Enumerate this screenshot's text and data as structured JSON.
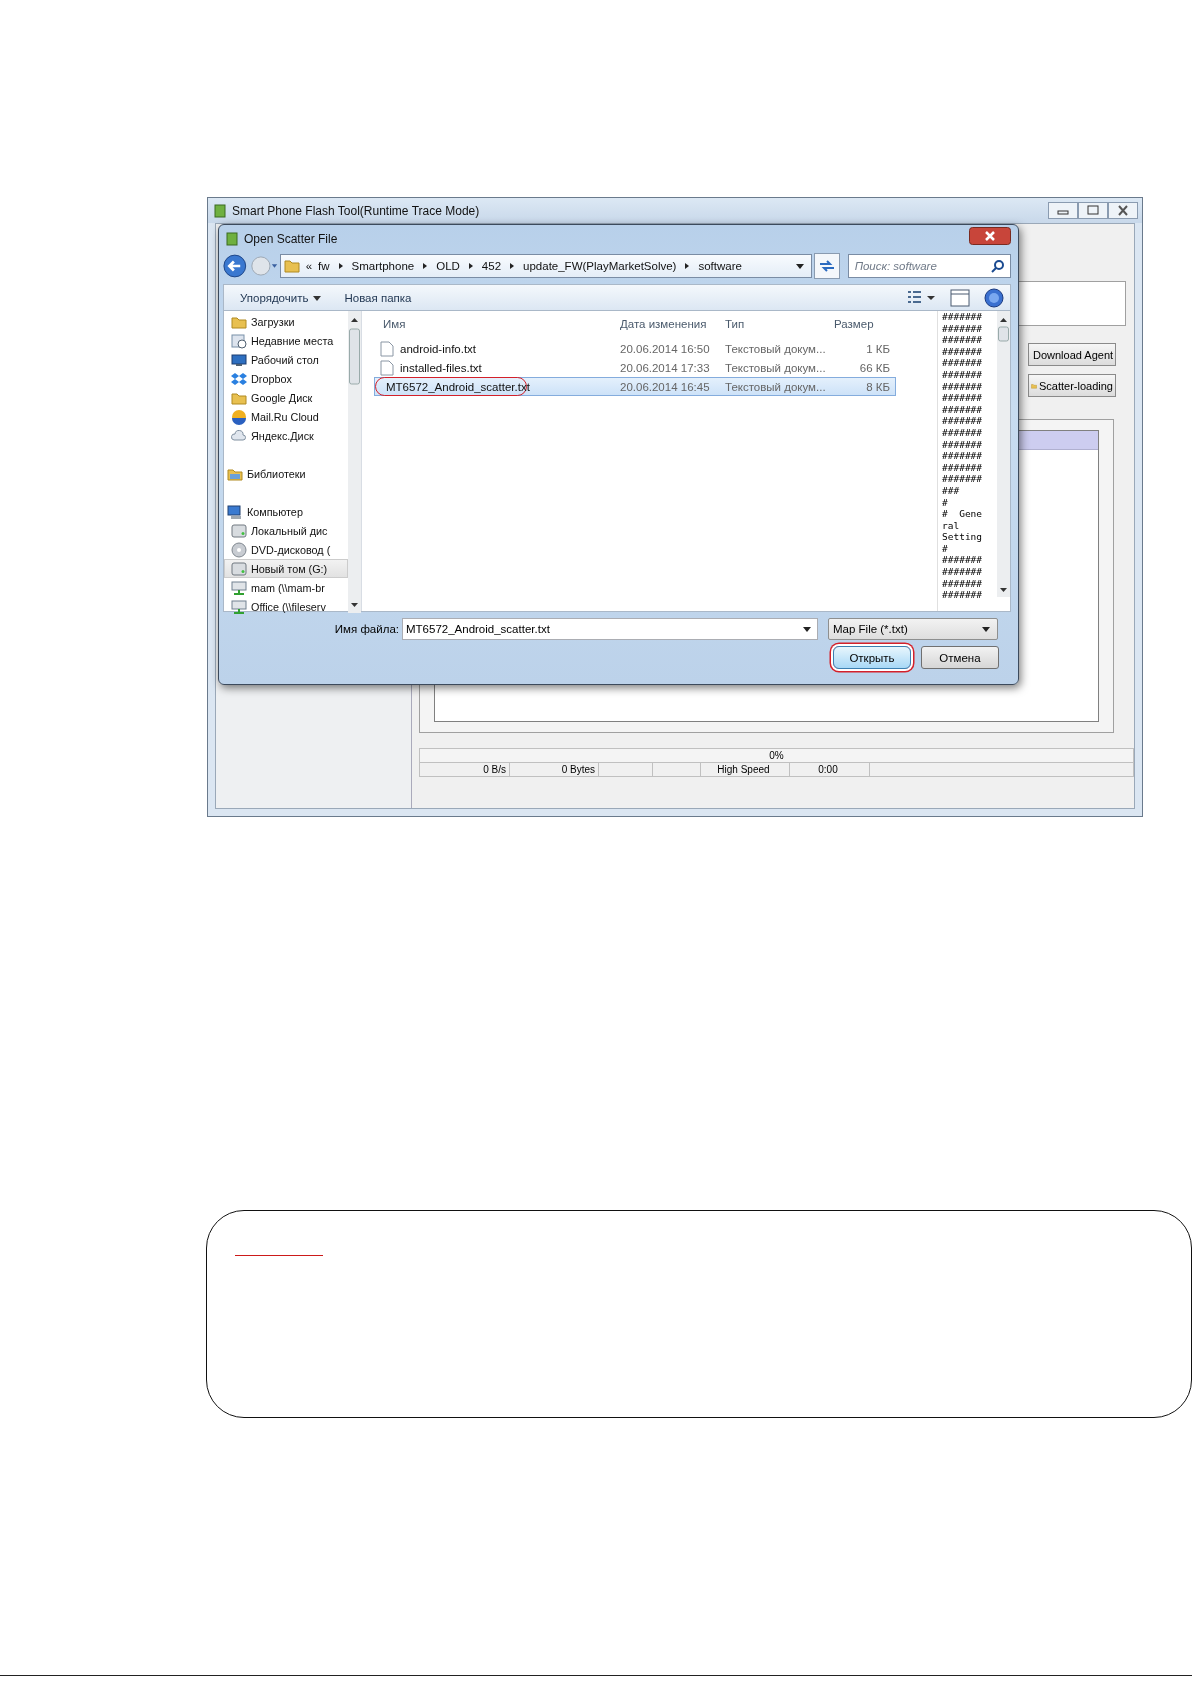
{
  "main_window": {
    "title": "Smart Phone Flash Tool(Runtime Trace Mode)",
    "buttons": [
      {
        "label": "Download Agent"
      },
      {
        "label": "Scatter-loading"
      }
    ],
    "progress": {
      "text": "0%",
      "level": 0
    },
    "status_cells": [
      {
        "text": "0 B/s"
      },
      {
        "text": "0 Bytes"
      },
      {},
      {},
      {
        "text": "High Speed"
      },
      {
        "text": "0:00"
      },
      {}
    ]
  },
  "dialog": {
    "title": "Open Scatter File",
    "breadcrumb": [
      "«",
      "fw",
      "Smartphone",
      "OLD",
      "452",
      "update_FW(PlayMarketSolve)",
      "software"
    ],
    "search": {
      "placeholder": "Поиск: software"
    },
    "toolbar": [
      {
        "label": "Упорядочить",
        "menu": true
      },
      {
        "label": "Новая папка",
        "menu": false
      }
    ],
    "nav": [
      {
        "children": [
          {
            "label": "Загрузки",
            "kind": "folder",
            "selected": false
          },
          {
            "label": "Недавние места",
            "kind": "recent",
            "selected": false
          },
          {
            "label": "Рабочий стол",
            "kind": "desktop",
            "selected": false
          },
          {
            "label": "Dropbox",
            "kind": "dropbox",
            "selected": false
          },
          {
            "label": "Google Диск",
            "kind": "folder",
            "selected": false
          },
          {
            "label": "Mail.Ru Cloud",
            "kind": "sphere",
            "selected": false
          },
          {
            "label": "Яндекс.Диск",
            "kind": "cloud",
            "selected": false
          }
        ]
      },
      {
        "label": "Библиотеки",
        "kind": "library",
        "selected": false
      },
      {
        "label": "Компьютер",
        "kind": "computer",
        "selected": false,
        "children": [
          {
            "label": "Локальный дис",
            "kind": "drive",
            "selected": false
          },
          {
            "label": "DVD-дисковод (",
            "kind": "dvd",
            "selected": false
          },
          {
            "label": "Новый том (G:)",
            "kind": "drive",
            "selected": true
          },
          {
            "label": "mam (\\\\mam-br",
            "kind": "network",
            "selected": false
          },
          {
            "label": "Office (\\\\fileserv",
            "kind": "network",
            "selected": false
          }
        ]
      }
    ],
    "columns": [
      "Имя",
      "Дата изменения",
      "Тип",
      "Размер"
    ],
    "files": [
      {
        "name": "android-info.txt",
        "date": "20.06.2014 16:50",
        "type": "Текстовый докум...",
        "size": "1 КБ",
        "selected": false,
        "circled": false
      },
      {
        "name": "installed-files.txt",
        "date": "20.06.2014 17:33",
        "type": "Текстовый докум...",
        "size": "66 КБ",
        "selected": false,
        "circled": false
      },
      {
        "name": "MT6572_Android_scatter.txt",
        "date": "20.06.2014 16:45",
        "type": "Текстовый докум...",
        "size": "8 КБ",
        "selected": true,
        "circled": true
      }
    ],
    "preview_lines": [
      "#######",
      "#######",
      "#######",
      "#######",
      "#######",
      "#######",
      "#######",
      "#######",
      "#######",
      "#######",
      "#######",
      "#######",
      "#######",
      "#######",
      "#######",
      "###",
      "#",
      "#  Gene",
      "ral",
      "Setting",
      "#",
      "#######",
      "#######",
      "#######",
      "#######"
    ],
    "filename": {
      "label": "Имя файла:",
      "value": "MT6572_Android_scatter.txt"
    },
    "filetype": "Map File (*.txt)",
    "buttons": [
      {
        "label": "Открыть",
        "default": true,
        "circled": true
      },
      {
        "label": "Отмена",
        "default": false,
        "circled": false
      }
    ]
  }
}
